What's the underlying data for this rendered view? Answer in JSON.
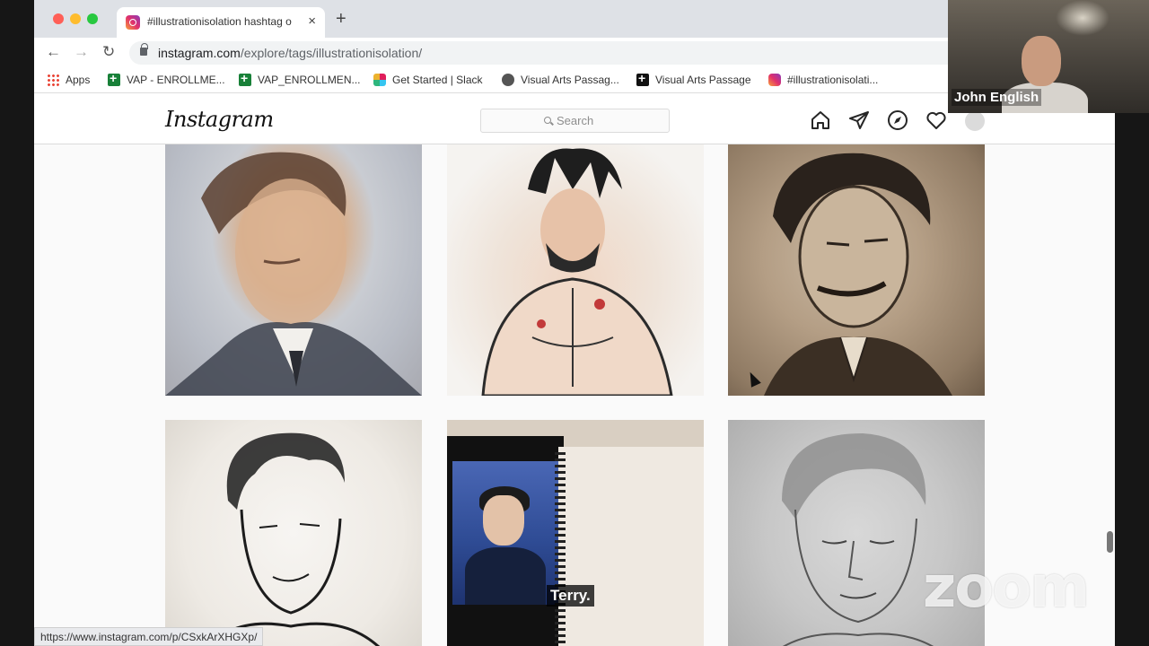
{
  "browser": {
    "tab_title": "#illustrationisolation hashtag o",
    "new_tab_symbol": "+",
    "close_symbol": "×",
    "url_host": "instagram.com",
    "url_path": "/explore/tags/illustrationisolation/",
    "nav": {
      "back": "←",
      "forward": "→",
      "reload": "↻"
    },
    "bookmarks": [
      {
        "label": "Apps",
        "icon": "apps-grid-icon"
      },
      {
        "label": "VAP - ENROLLME...",
        "icon": "sheets-icon"
      },
      {
        "label": "VAP_ENROLLMEN...",
        "icon": "sheets-icon"
      },
      {
        "label": "Get Started | Slack",
        "icon": "slack-icon"
      },
      {
        "label": "Visual Arts Passag...",
        "icon": "globe-icon"
      },
      {
        "label": "Visual Arts Passage",
        "icon": "plus-square-icon"
      },
      {
        "label": "#illustrationisolati...",
        "icon": "instagram-icon"
      }
    ],
    "status_url": "https://www.instagram.com/p/CSxkArXHGXp/"
  },
  "instagram": {
    "logo": "Instagram",
    "search_placeholder": "Search",
    "nav_icons": [
      "home-icon",
      "direct-icon",
      "explore-icon",
      "activity-heart-icon",
      "profile-avatar"
    ],
    "posts": [
      {
        "subject": "watercolor portrait young man in suit"
      },
      {
        "subject": "ink and watercolor shirtless clawed figure"
      },
      {
        "subject": "charcoal portrait boy in blazer"
      },
      {
        "subject": "ink line drawing curly-haired youth"
      },
      {
        "subject": "laptop video reference beside sketchbook"
      },
      {
        "subject": "pencil sketch young man eyes closed"
      }
    ]
  },
  "zoom": {
    "participant_name": "John English",
    "caption": "Terry.",
    "watermark": "zoom"
  },
  "colors": {
    "tab_strip": "#dee1e6",
    "instagram_border": "#dbdbdb",
    "traffic_red": "#ff5f57",
    "traffic_yellow": "#febc2e",
    "traffic_green": "#28c840"
  }
}
